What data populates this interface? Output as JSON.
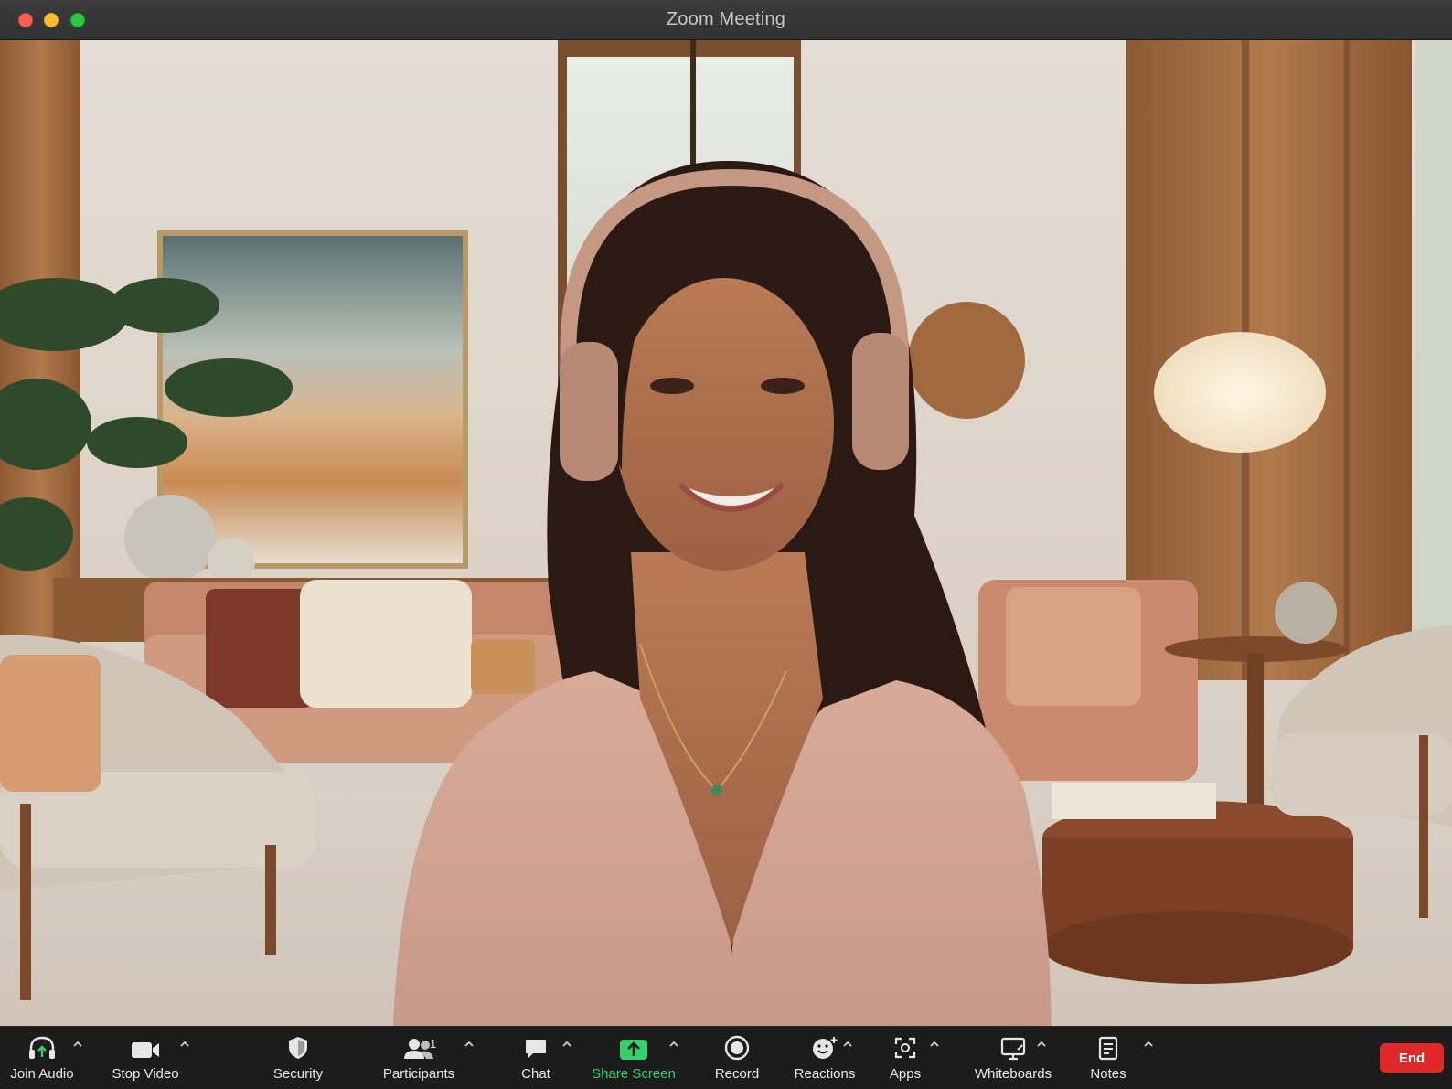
{
  "window": {
    "title": "Zoom Meeting"
  },
  "participant": {
    "description_icon": "camera-feed"
  },
  "toolbar": {
    "join_audio": "Join Audio",
    "stop_video": "Stop Video",
    "security": "Security",
    "participants": "Participants",
    "participants_count": "1",
    "chat": "Chat",
    "share_screen": "Share Screen",
    "record": "Record",
    "reactions": "Reactions",
    "apps": "Apps",
    "whiteboards": "Whiteboards",
    "notes": "Notes",
    "end": "End"
  },
  "colors": {
    "share_screen_accent": "#31d16b",
    "end_button": "#e02828",
    "toolbar_bg": "#1c1c1c",
    "titlebar_bg": "#363636"
  },
  "icons": {
    "join_audio": "headphone-icon",
    "stop_video": "video-camera-icon",
    "security": "shield-icon",
    "participants": "people-icon",
    "chat": "chat-bubble-icon",
    "share_screen": "share-arrow-icon",
    "record": "record-icon",
    "reactions": "smiley-plus-icon",
    "apps": "apps-icon",
    "whiteboards": "whiteboard-icon",
    "notes": "notes-icon"
  }
}
